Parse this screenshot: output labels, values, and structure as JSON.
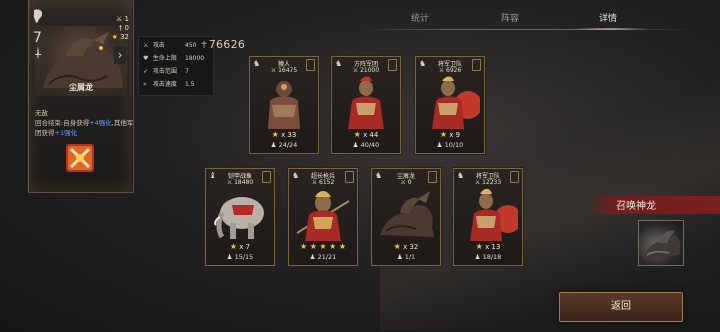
{
  "tabs": [
    {
      "label": "统计",
      "active": false
    },
    {
      "label": "阵容",
      "active": false
    },
    {
      "label": "详情",
      "active": true
    }
  ],
  "hero": {
    "emblem_icon": "dragon-crest-icon",
    "level": "7",
    "mini_icon": "sword-icon",
    "stats": [
      "1",
      "0",
      "32"
    ],
    "name": "尘屑龙",
    "desc_plain_1": "无敌",
    "desc_plain_2": "回合结束:自身获得",
    "desc_hl_1": "+4强化",
    "desc_plain_3": ",其他军团获得",
    "desc_hl_2": "+1强化",
    "skill_icon": "crossed-swords-fire-icon"
  },
  "stats": [
    {
      "icon": "attack-icon",
      "label": "攻击",
      "value": "450"
    },
    {
      "icon": "heart-icon",
      "label": "生命上限",
      "value": "18000"
    },
    {
      "icon": "range-icon",
      "label": "攻击范围",
      "value": "7"
    },
    {
      "icon": "speed-icon",
      "label": "攻击速度",
      "value": "1.5"
    }
  ],
  "total_power": "76626",
  "units_row1": [
    {
      "name": "猿人",
      "power": "16475",
      "count": "x 33",
      "troops": "24/24"
    },
    {
      "name": "方阵军团",
      "power": "21000",
      "count": "x 44",
      "troops": "40/40"
    },
    {
      "name": "将军卫队",
      "power": "6926",
      "count": "x 9",
      "troops": "10/10"
    }
  ],
  "units_row2": [
    {
      "name": "铠甲战象",
      "power": "18480",
      "count": "x 7",
      "troops": "15/15"
    },
    {
      "name": "超长枪兵",
      "power": "6152",
      "count": "",
      "stars": 5,
      "troops": "21/21"
    },
    {
      "name": "尘屑龙",
      "power": "0",
      "count": "x 32",
      "troops": "1/1"
    },
    {
      "name": "将军卫队",
      "power": "12233",
      "count": "x 13",
      "troops": "18/18"
    }
  ],
  "summon": {
    "label": "召唤神龙",
    "icon": "dragon-icon"
  },
  "return_label": "返回",
  "colors": {
    "accent_gold": "#c9a66b",
    "star": "#f2c14a",
    "banner_red": "#7c1f1f",
    "highlight_blue": "#5fa8ff"
  }
}
